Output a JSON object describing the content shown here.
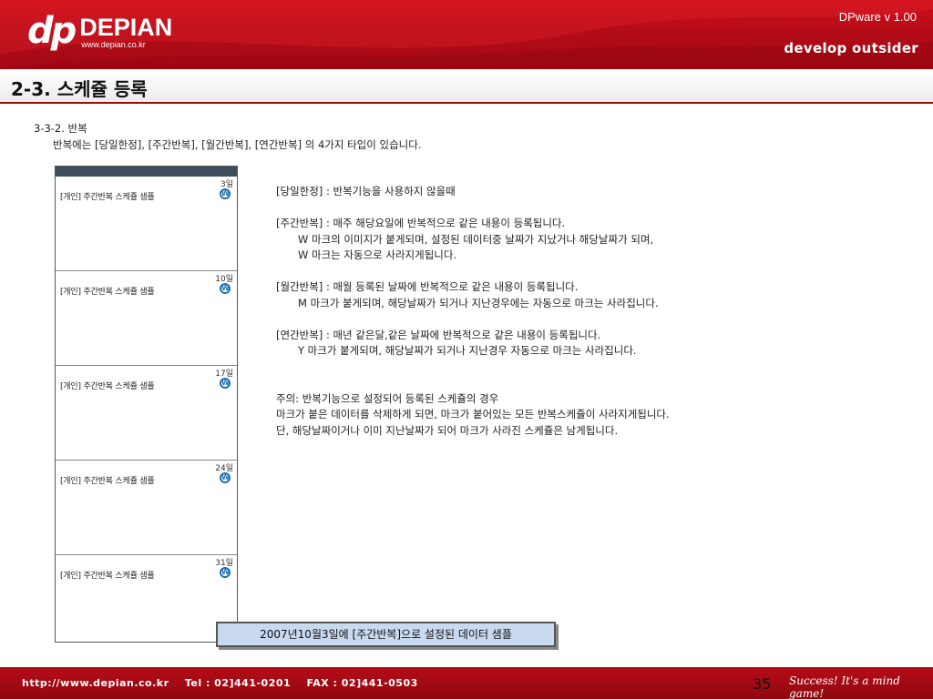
{
  "header": {
    "logo_dp": "dp",
    "logo_name": "DEPIAN",
    "logo_url": "www.depian.co.kr",
    "version": "DPware v 1.00",
    "tagline": "develop outsider"
  },
  "title": "2-3. 스케쥴 등록",
  "section": {
    "heading": "3-3-2. 반복",
    "description": "반복에는 [당일한정], [주간반복], [월간반복], [연간반복] 의 4가지 타입이 있습니다."
  },
  "calendar": {
    "icon": "w-repeat-icon",
    "mark_letter": "W",
    "cells": [
      {
        "day": "3일",
        "event": "[개인] 주간반복 스케쥴 샘플"
      },
      {
        "day": "10일",
        "event": "[개인] 주간반복 스케쥴 샘플"
      },
      {
        "day": "17일",
        "event": "[개인] 주간반복 스케쥴 샘플"
      },
      {
        "day": "24일",
        "event": "[개인] 주간반복 스케쥴 샘플"
      },
      {
        "day": "31일",
        "event": "[개인] 주간반복 스케쥴 샘플"
      }
    ]
  },
  "caption": "2007년10월3일에 [주간반복]으로 설정된 데이터 샘플",
  "explain": {
    "daily": "[당일한정] : 반복기능을 사용하지 않을때",
    "weekly": "[주간반복] : 매주 해당요일에 반복적으로 같은 내용이 등록됩니다.",
    "weekly_1": "W 마크의 이미지가 붙게되며, 설정된 데이터중 날짜가 지났거나 해당날짜가 되며,",
    "weekly_2": "W 마크는 자동으로 사라지게됩니다.",
    "monthly": "[월간반복] : 매월 등록된 날짜에 반복적으로 같은 내용이 등록됩니다.",
    "monthly_1": "M 마크가 붙게되며, 해당날짜가 되거나 지난경우에는 자동으로 마크는 사라집니다.",
    "yearly": "[연간반복] : 매년 같은달,같은 날짜에 반복적으로 같은 내용이 등록됩니다.",
    "yearly_1": "Y 마크가 붙게되며, 해당날짜가 되거나 지난경우 자동으로 마크는 사라집니다.",
    "note_1": "주의: 반복기능으로 설정되어 등록된 스케쥴의 경우",
    "note_2": "마크가 붙은 데이터를 삭제하게 되면, 마크가 붙어있는 모든 반복스케쥴이 사라지게됩니다.",
    "note_3": "단, 해당날짜이거나 이미 지난날짜가 되어 마크가 사라진 스케쥴은 남게됩니다."
  },
  "footer": {
    "info": "http://www.depian.co.kr    Tel : 02]441-0201    FAX : 02]441-0503",
    "page": "35",
    "slogan": "Success! It's a mind game!"
  },
  "colors": {
    "brand_red": "#b40c17",
    "calendar_bar": "#3d4e5c",
    "caption_bg": "#c9d9ef",
    "mark_blue": "#1d6fb0"
  }
}
